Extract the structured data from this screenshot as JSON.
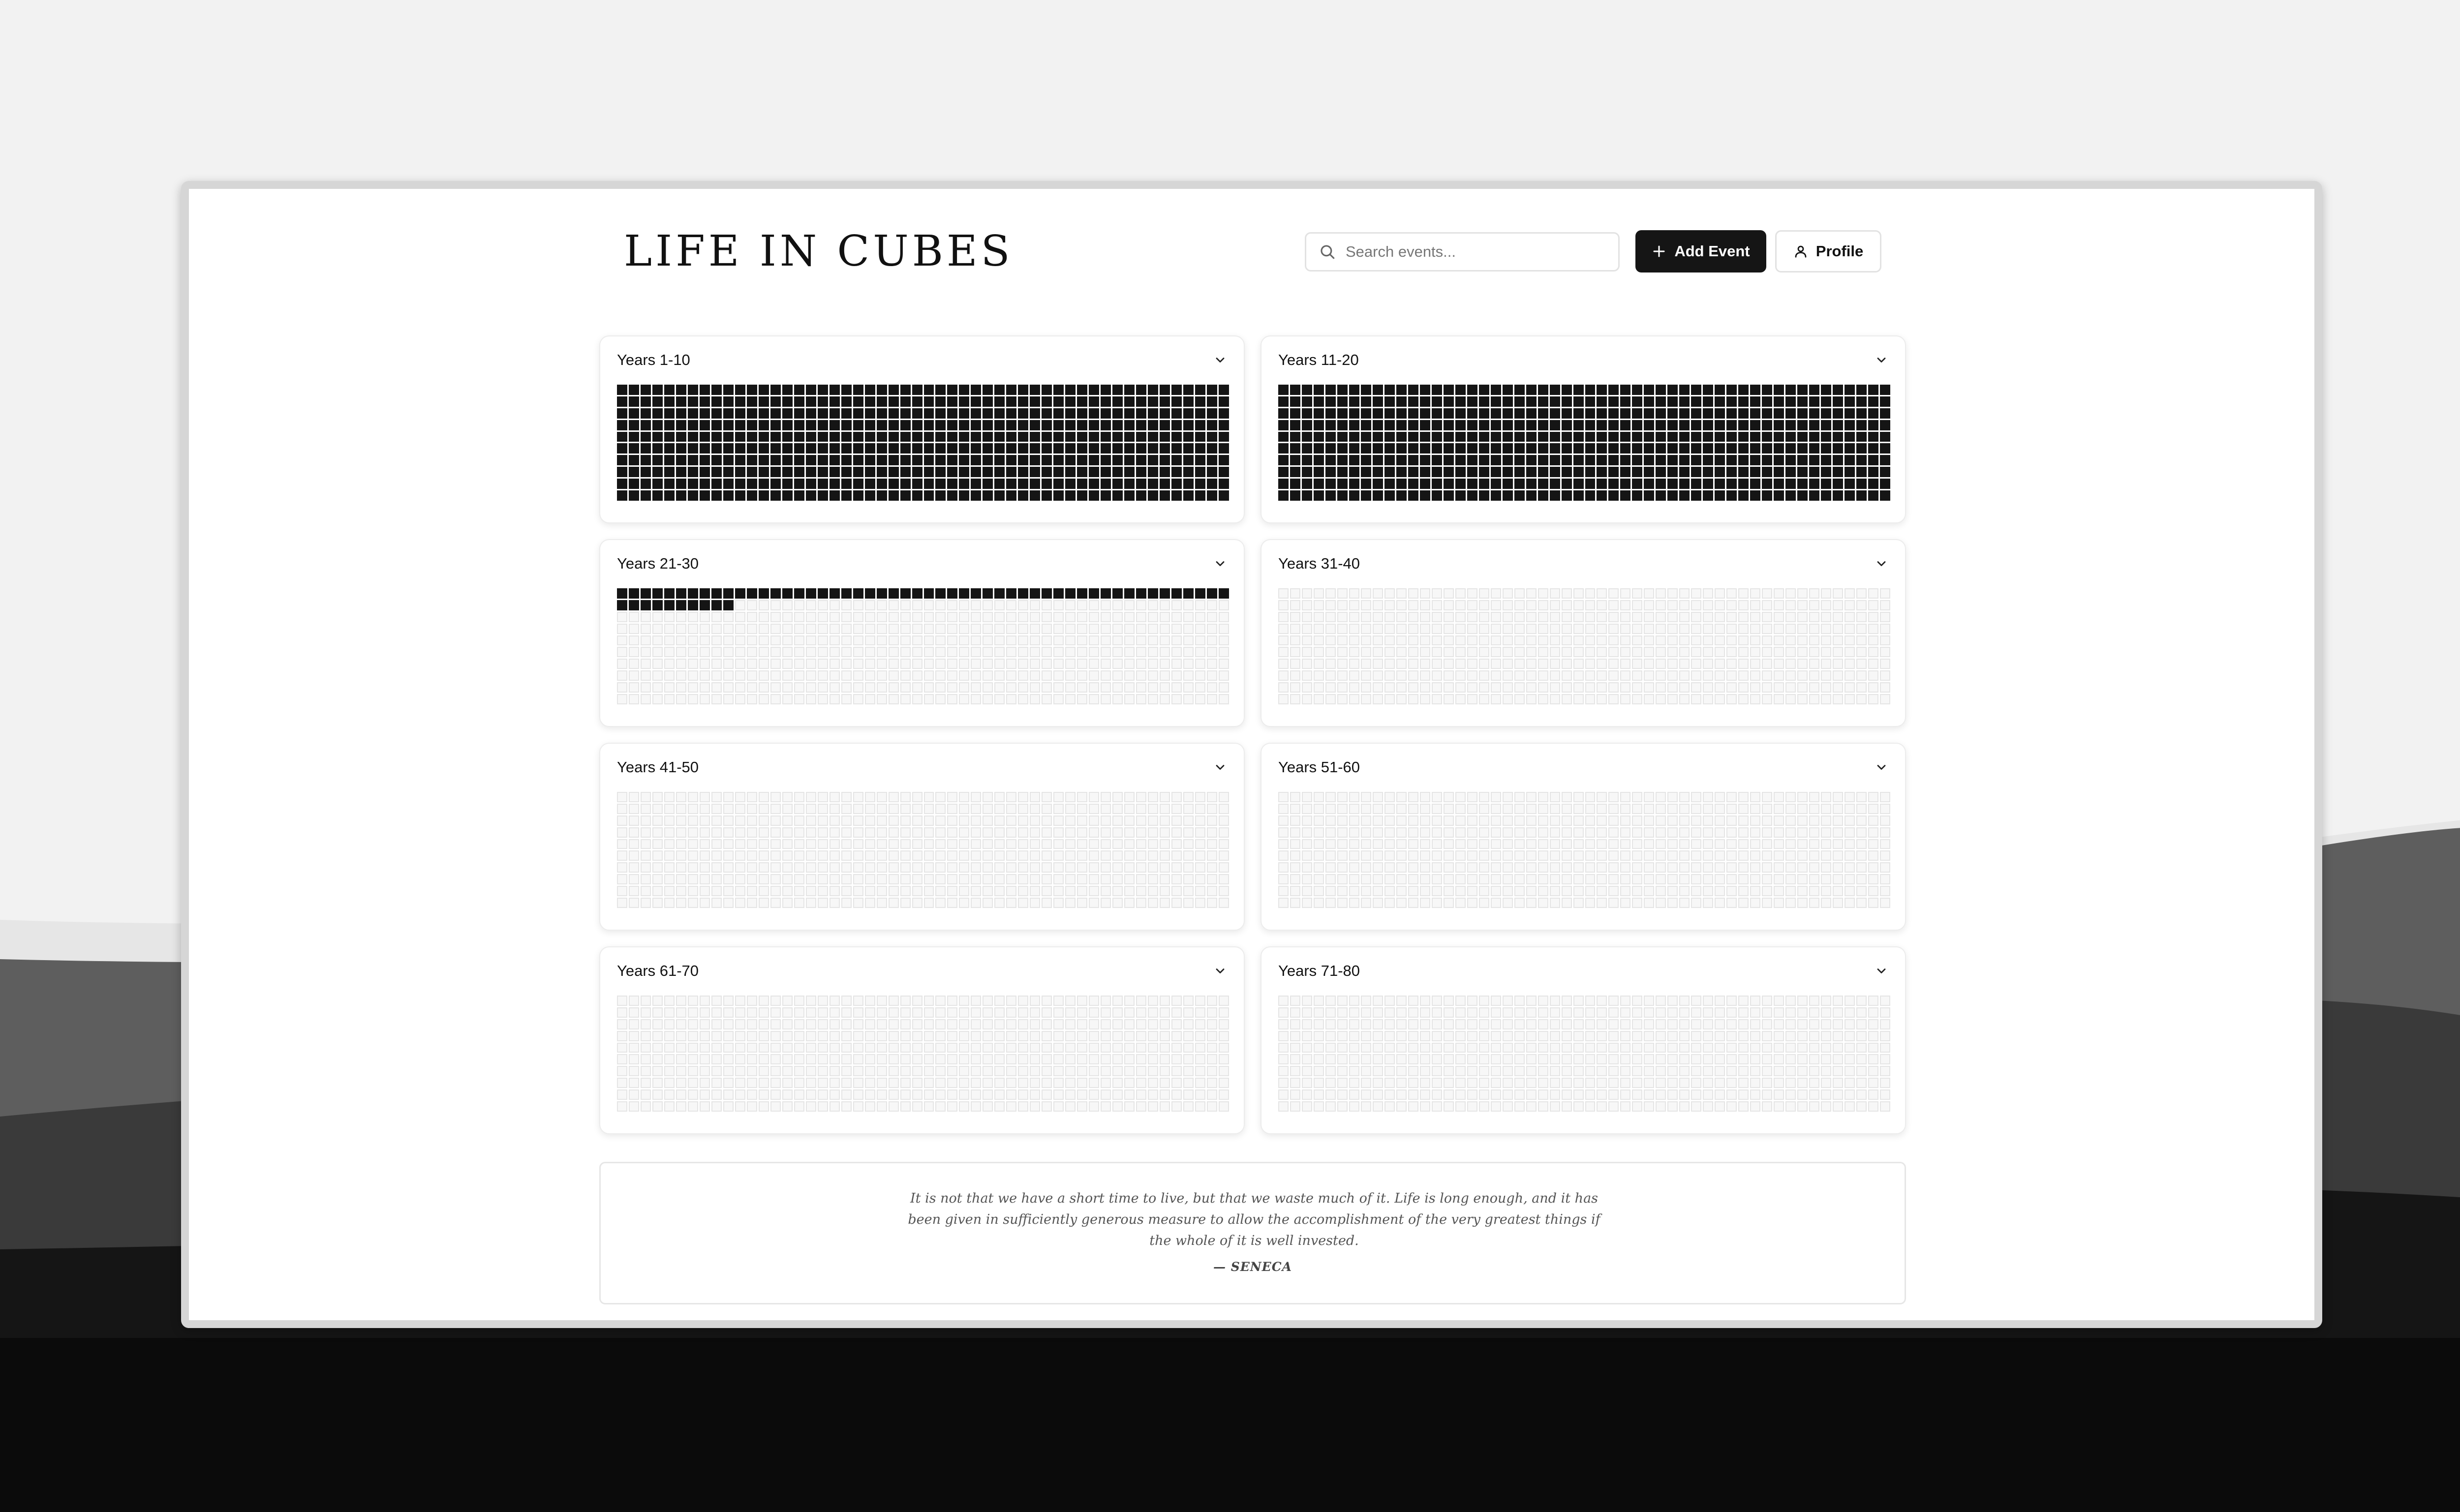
{
  "app": {
    "title": "LIFE IN CUBES"
  },
  "header": {
    "search_placeholder": "Search events...",
    "add_event_label": "Add Event",
    "profile_label": "Profile"
  },
  "theme": {
    "filled": "#151515",
    "empty": "#f7f7f7",
    "empty_border": "#e5e5e5"
  },
  "weeks_per_year": 52,
  "decades": [
    {
      "label": "Years 1-10",
      "filled_weeks": 520
    },
    {
      "label": "Years 11-20",
      "filled_weeks": 520
    },
    {
      "label": "Years 21-30",
      "filled_weeks": 62
    },
    {
      "label": "Years 31-40",
      "filled_weeks": 0
    },
    {
      "label": "Years 41-50",
      "filled_weeks": 0
    },
    {
      "label": "Years 51-60",
      "filled_weeks": 0
    },
    {
      "label": "Years 61-70",
      "filled_weeks": 0
    },
    {
      "label": "Years 71-80",
      "filled_weeks": 0
    }
  ],
  "quote": {
    "text": "It is not that we have a short time to live, but that we waste much of it. Life is long enough, and it has been given in sufficiently generous measure to allow the accomplishment of the very greatest things if the whole of it is well invested.",
    "author": "— SENECA"
  }
}
